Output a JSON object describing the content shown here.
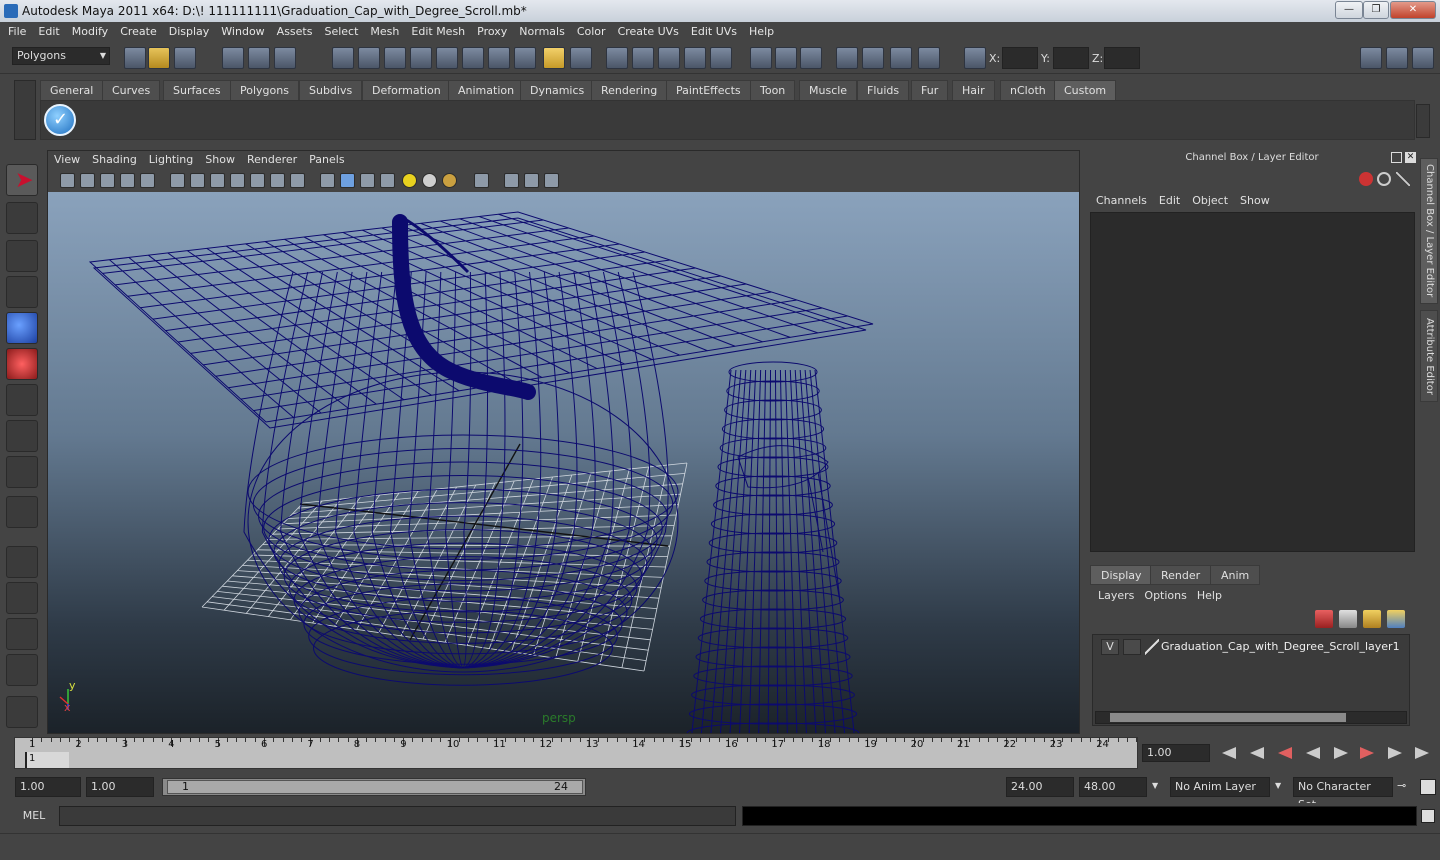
{
  "window": {
    "title": "Autodesk Maya 2011 x64: D:\\! 111111111\\Graduation_Cap_with_Degree_Scroll.mb*",
    "minimize": "—",
    "maximize": "❐",
    "close": "✕"
  },
  "menubar": [
    "File",
    "Edit",
    "Modify",
    "Create",
    "Display",
    "Window",
    "Assets",
    "Select",
    "Mesh",
    "Edit Mesh",
    "Proxy",
    "Normals",
    "Color",
    "Create UVs",
    "Edit UVs",
    "Help"
  ],
  "status": {
    "mode": "Polygons",
    "x_label": "X:",
    "y_label": "Y:",
    "z_label": "Z:"
  },
  "shelf": {
    "tabs": [
      "General",
      "Curves",
      "Surfaces",
      "Polygons",
      "Subdivs",
      "Deformation",
      "Animation",
      "Dynamics",
      "Rendering",
      "PaintEffects",
      "Toon",
      "Muscle",
      "Fluids",
      "Fur",
      "Hair",
      "nCloth",
      "Custom"
    ],
    "active": "Custom"
  },
  "viewport": {
    "menu": [
      "View",
      "Shading",
      "Lighting",
      "Show",
      "Renderer",
      "Panels"
    ],
    "camera": "persp",
    "axis_x": "x",
    "axis_y": "y",
    "wire_color": "#0c0a6e"
  },
  "channelbox": {
    "title": "Channel Box / Layer Editor",
    "menu": [
      "Channels",
      "Edit",
      "Object",
      "Show"
    ]
  },
  "layer_editor": {
    "tabs": [
      "Display",
      "Render",
      "Anim"
    ],
    "active": "Display",
    "menu": [
      "Layers",
      "Options",
      "Help"
    ],
    "layer_visibility": "V",
    "layer_name": "Graduation_Cap_with_Degree_Scroll_layer1"
  },
  "side_tabs": [
    "Channel Box / Layer Editor",
    "Attribute Editor"
  ],
  "timeline": {
    "ticks": [
      "1",
      "2",
      "3",
      "4",
      "5",
      "6",
      "7",
      "8",
      "9",
      "10",
      "11",
      "12",
      "13",
      "14",
      "15",
      "16",
      "17",
      "18",
      "19",
      "20",
      "21",
      "22",
      "23",
      "24"
    ],
    "current_marker": "1",
    "current_time": "1.00"
  },
  "range": {
    "start": "1.00",
    "playback_start": "1.00",
    "slider_start": "1",
    "slider_end": "24",
    "playback_end": "24.00",
    "end": "48.00",
    "anim_layer": "No Anim Layer",
    "character_set": "No Character Set"
  },
  "command": {
    "label": "MEL"
  }
}
